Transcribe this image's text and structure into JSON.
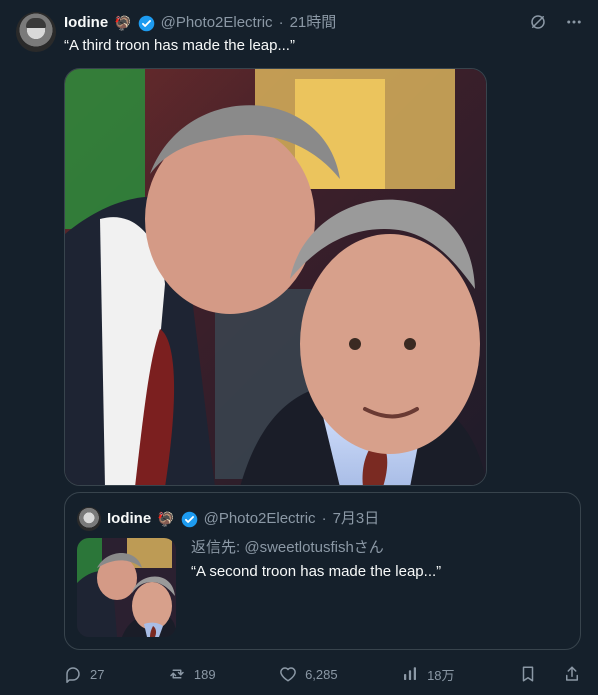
{
  "tweet": {
    "author_name": "Iodine",
    "emoji": "🦃",
    "handle": "@Photo2Electric",
    "separator": "·",
    "time": "21時間",
    "text": "“A third troon has made the leap...”"
  },
  "quote": {
    "author_name": "Iodine",
    "emoji": "🦃",
    "handle": "@Photo2Electric",
    "separator": "·",
    "date": "7月3日",
    "reply_prefix": "返信先:",
    "reply_to": "@sweetlotusfishさん",
    "text": "“A second troon has made the leap...”"
  },
  "actions": {
    "reply_count": "27",
    "retweet_count": "189",
    "like_count": "6,285",
    "view_count": "18万"
  },
  "icons": {
    "verified": "verified-badge-icon",
    "grok": "grok-icon",
    "more": "more-icon",
    "reply": "reply-icon",
    "retweet": "retweet-icon",
    "like": "like-icon",
    "views": "views-icon",
    "bookmark": "bookmark-icon",
    "share": "share-icon"
  },
  "colors": {
    "background": "#15202b",
    "text": "#f7f9f9",
    "muted": "#8b98a5",
    "border": "#38444d",
    "verified": "#1d9bf0"
  }
}
